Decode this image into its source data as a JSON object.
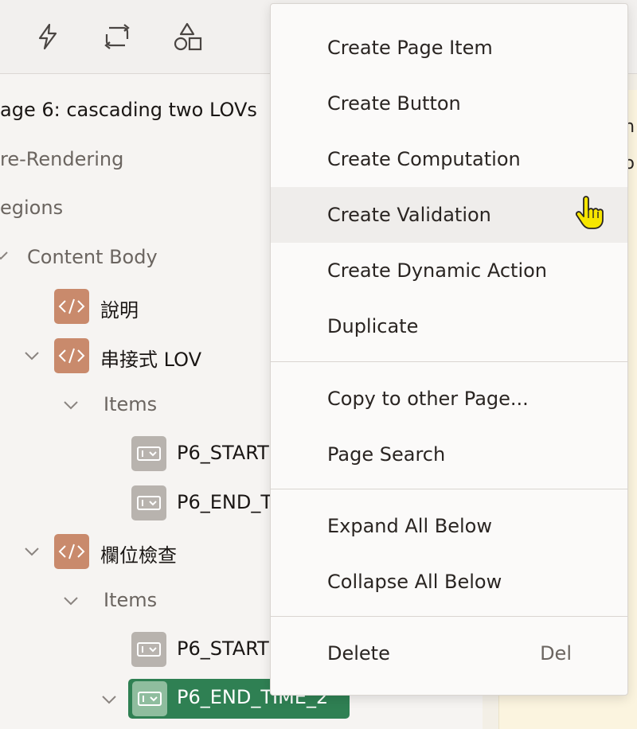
{
  "toolbar": {
    "icons": [
      "lightning-icon",
      "shared-components-icon",
      "shapes-icon"
    ]
  },
  "tree": {
    "page_title": "age 6: cascading two LOVs",
    "pre_rendering": "re-Rendering",
    "regions": "egions",
    "content_body": "Content Body",
    "region1": "說明",
    "region2": "串接式 LOV",
    "items_label_1": "Items",
    "item_start_1": "P6_START",
    "item_end_1": "P6_END_T",
    "region3": "欄位檢查",
    "items_label_2": "Items",
    "item_start_2": "P6_START",
    "item_end_2_selected": "P6_END_TIME_2"
  },
  "right_pane": {
    "line1": "m",
    "line2": "o"
  },
  "context_menu": {
    "items": [
      {
        "label": "Create Page Item"
      },
      {
        "label": "Create Button"
      },
      {
        "label": "Create Computation"
      },
      {
        "label": "Create Validation"
      },
      {
        "label": "Create Dynamic Action"
      },
      {
        "label": "Duplicate"
      },
      {
        "label": "Copy to other Page..."
      },
      {
        "label": "Page Search"
      },
      {
        "label": "Expand All Below"
      },
      {
        "label": "Collapse All Below"
      },
      {
        "label": "Delete",
        "shortcut": "Del"
      }
    ],
    "hovered_item": "Create Validation"
  },
  "colors": {
    "region_icon": "#c98a6c",
    "item_icon": "#b8b3ae",
    "selected_bg": "#2f8053",
    "menu_hover": "#efedeb"
  }
}
